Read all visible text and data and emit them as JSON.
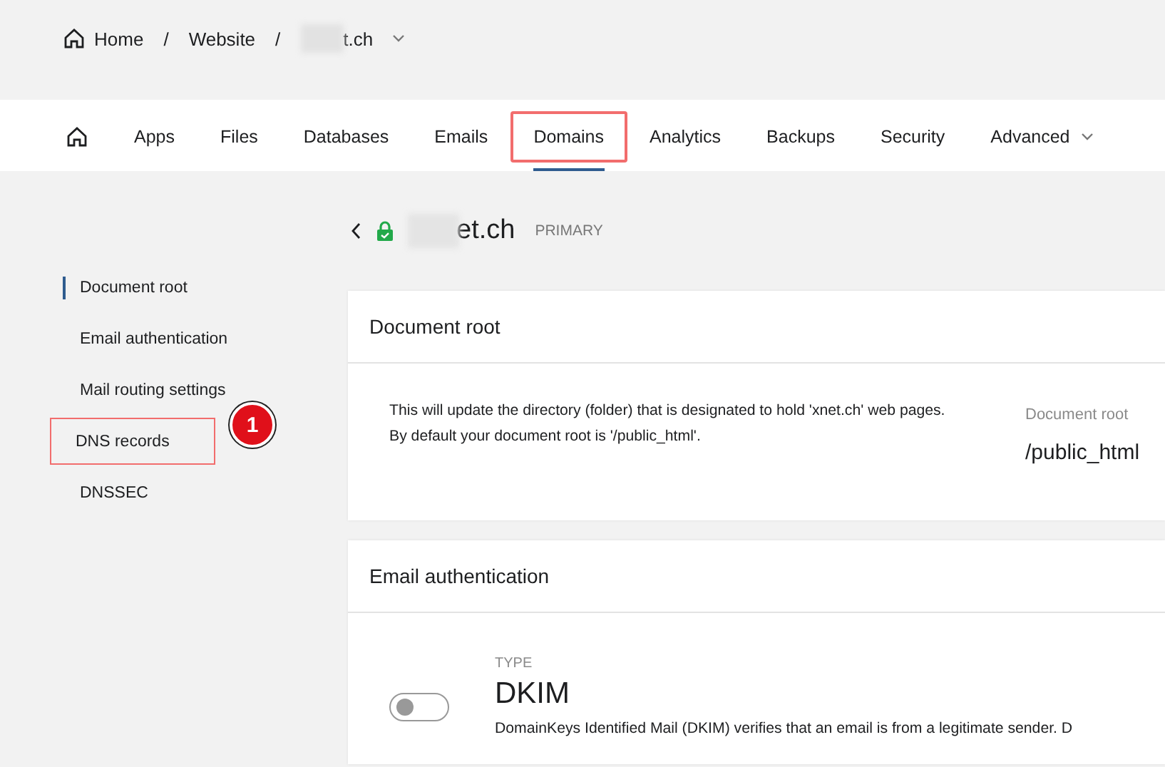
{
  "breadcrumb": {
    "items": [
      {
        "label": "Home",
        "kind": "home"
      },
      {
        "separator": "/",
        "label": "Website",
        "kind": "text"
      },
      {
        "separator": "/",
        "label": "t.ch",
        "kind": "domain"
      }
    ]
  },
  "nav": {
    "tabs": [
      {
        "kind": "home",
        "selected": false,
        "highlighted": false
      },
      {
        "label": "Apps",
        "kind": "text",
        "selected": false,
        "highlighted": false
      },
      {
        "label": "Files",
        "kind": "text",
        "selected": false,
        "highlighted": false
      },
      {
        "label": "Databases",
        "kind": "text",
        "selected": false,
        "highlighted": false
      },
      {
        "label": "Emails",
        "kind": "text",
        "selected": false,
        "highlighted": false
      },
      {
        "label": "Domains",
        "kind": "text",
        "selected": true,
        "highlighted": true
      },
      {
        "label": "Analytics",
        "kind": "text",
        "selected": false,
        "highlighted": false
      },
      {
        "label": "Backups",
        "kind": "text",
        "selected": false,
        "highlighted": false
      },
      {
        "label": "Security",
        "kind": "text",
        "selected": false,
        "highlighted": false
      },
      {
        "label": "Advanced",
        "kind": "menu",
        "selected": false,
        "highlighted": false
      }
    ]
  },
  "domain_header": {
    "name": "et.ch",
    "badge": "PRIMARY",
    "secure": true
  },
  "sidebar": {
    "items": [
      {
        "label": "Document root",
        "selected": true,
        "highlighted": false
      },
      {
        "label": "Email authentication",
        "selected": false,
        "highlighted": false
      },
      {
        "label": "Mail routing settings",
        "selected": false,
        "highlighted": false
      },
      {
        "label": "DNS records",
        "selected": false,
        "highlighted": true,
        "step": "1"
      },
      {
        "label": "DNSSEC",
        "selected": false,
        "highlighted": false
      }
    ]
  },
  "document_root": {
    "title": "Document root",
    "description": "This will update the directory (folder) that is designated to hold 'xnet.ch' web pages. By default your document root is '/public_html'.",
    "field_label": "Document root",
    "field_value": "/public_html"
  },
  "email_authentication": {
    "title": "Email authentication",
    "type_label": "TYPE",
    "type": "DKIM",
    "on": false,
    "description": "DomainKeys Identified Mail (DKIM) verifies that an email is from a legitimate sender. D"
  }
}
